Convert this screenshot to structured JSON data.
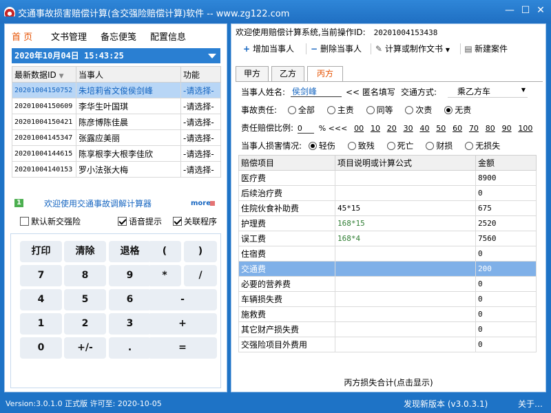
{
  "window": {
    "title": "交通事故损害赔偿计算(含交强险赔偿计算)软件 -- www.zg122.com",
    "min_symbol": "—",
    "max_symbol": "☐",
    "close_symbol": "✕"
  },
  "left": {
    "menu": [
      "首 页",
      "文书管理",
      "备忘便笺",
      "配置信息"
    ],
    "datetime": "2020年10月04日 15:43:25",
    "grid": {
      "headers": [
        "最新数据ID",
        "当事人",
        "功能"
      ],
      "rows": [
        {
          "id": "20201004150752",
          "name": "朱培莉省文俊侯剑峰",
          "func": "-请选择-"
        },
        {
          "id": "20201004150609",
          "name": "李华生叶国琪",
          "func": "-请选择-"
        },
        {
          "id": "20201004150421",
          "name": "陈彦博陈佳晨",
          "func": "-请选择-"
        },
        {
          "id": "20201004145347",
          "name": "张露应美丽",
          "func": "-请选择-"
        },
        {
          "id": "20201004144615",
          "name": "陈享根李大根李佳欣",
          "func": "-请选择-"
        },
        {
          "id": "20201004140153",
          "name": "罗小法张大梅",
          "func": "-请选择-"
        }
      ]
    },
    "welcome_num": "1",
    "welcome_text": "欢迎使用交通事故调解计算器",
    "more": "more",
    "options": {
      "new_rule": "默认新交强险",
      "voice": "语音提示",
      "link": "关联程序"
    },
    "calc": [
      [
        "打印",
        "清除",
        "退格",
        "(",
        ")"
      ],
      [
        "7",
        "8",
        "9",
        "*",
        "/"
      ],
      [
        "4",
        "5",
        "6",
        "-",
        ""
      ],
      [
        "1",
        "2",
        "3",
        "+",
        ""
      ],
      [
        "0",
        "+/-",
        ".",
        "=",
        ""
      ]
    ]
  },
  "right": {
    "welcome": "欢迎使用赔偿计算系统,当前操作ID:",
    "current_id": "20201004153438",
    "toolbar": {
      "add": "增加当事人",
      "delete": "删除当事人",
      "calc_doc": "计算或制作文书",
      "new_case": "新建案件"
    },
    "tabs": [
      "甲方",
      "乙方",
      "丙方"
    ],
    "party": {
      "name_label": "当事人姓名:",
      "name_value": "侯剑峰",
      "anon_label": "<< 匿名填写",
      "mode_label": "交通方式:",
      "mode_value": "乘乙方车",
      "liability_label": "事故责任:",
      "liability_options": [
        "全部",
        "主责",
        "同等",
        "次责",
        "无责"
      ],
      "ratio_label": "责任赔偿比例:",
      "ratio_value": "0",
      "ratio_unit": "% <<<",
      "ratio_options": [
        "00",
        "10",
        "20",
        "30",
        "40",
        "50",
        "60",
        "70",
        "80",
        "90",
        "100"
      ],
      "injury_label": "当事人损害情况:",
      "injury_options": [
        "轻伤",
        "致残",
        "死亡",
        "财损",
        "无损失"
      ]
    },
    "items_headers": [
      "赔偿项目",
      "项目说明或计算公式",
      "金额"
    ],
    "items": [
      {
        "name": "医疗费",
        "desc": "",
        "amount": "8900"
      },
      {
        "name": "后续治疗费",
        "desc": "",
        "amount": "0"
      },
      {
        "name": "住院伙食补助费",
        "desc": "45*15",
        "amount": "675"
      },
      {
        "name": "护理费",
        "desc": "168*15",
        "amount": "2520"
      },
      {
        "name": "误工费",
        "desc": "168*4",
        "amount": "7560"
      },
      {
        "name": "住宿费",
        "desc": "",
        "amount": "0"
      },
      {
        "name": "交通费",
        "desc": "",
        "amount": "200"
      },
      {
        "name": "必要的营养费",
        "desc": "",
        "amount": "0"
      },
      {
        "name": "车辆损失费",
        "desc": "",
        "amount": "0"
      },
      {
        "name": "施救费",
        "desc": "",
        "amount": "0"
      },
      {
        "name": "其它财产损失费",
        "desc": "",
        "amount": "0"
      },
      {
        "name": "交强险项目外费用",
        "desc": "",
        "amount": "0"
      }
    ],
    "total": "丙方损失合计(点击显示)"
  },
  "status": {
    "version": "Version:3.0.1.0 正式版 许可至: 2020-10-05",
    "new_version": "发现新版本 (v3.0.3.1)",
    "about": "关于…"
  }
}
